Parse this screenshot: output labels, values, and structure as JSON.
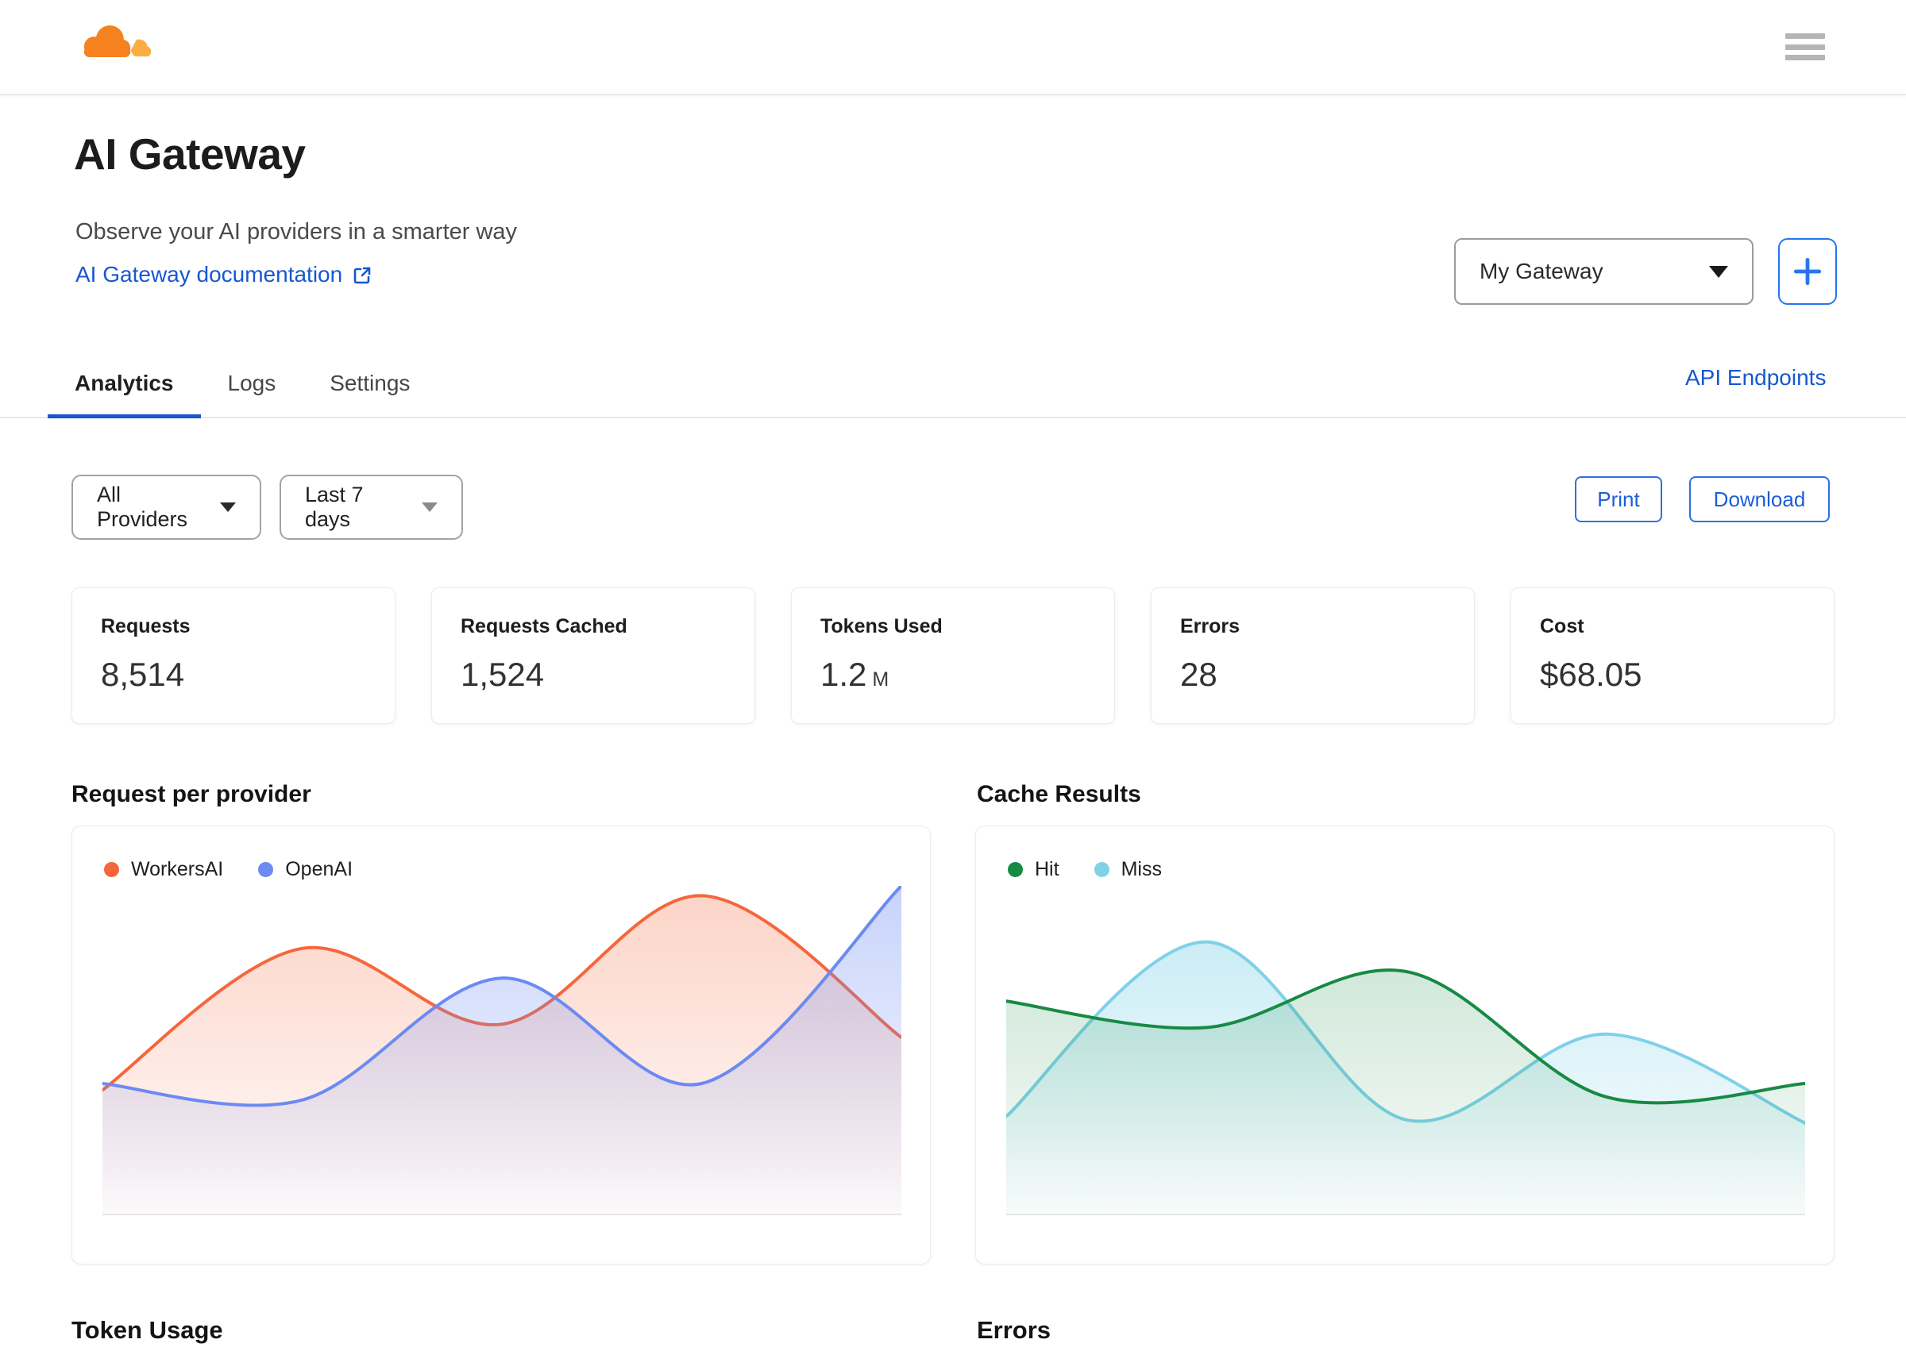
{
  "header": {
    "title": "AI Gateway",
    "subtitle": "Observe your AI providers in a smarter way",
    "doc_link_label": "AI Gateway documentation",
    "gateway_selected": "My Gateway"
  },
  "icons": {
    "menu": "hamburger-icon",
    "doc_external": "external-link-icon",
    "add_gateway": "plus-icon",
    "dropdowns": "chevron-down-icon",
    "logo": "cloudflare-cloud-logo"
  },
  "tabs": {
    "items": [
      {
        "label": "Analytics",
        "active": true
      },
      {
        "label": "Logs",
        "active": false
      },
      {
        "label": "Settings",
        "active": false
      }
    ],
    "api_endpoints_label": "API Endpoints"
  },
  "toolbar": {
    "provider_filter": "All Providers",
    "date_filter": "Last 7 days",
    "print_label": "Print",
    "download_label": "Download"
  },
  "stats": [
    {
      "label": "Requests",
      "value": "8,514",
      "suffix": ""
    },
    {
      "label": "Requests Cached",
      "value": "1,524",
      "suffix": ""
    },
    {
      "label": "Tokens Used",
      "value": "1.2",
      "suffix": "M"
    },
    {
      "label": "Errors",
      "value": "28",
      "suffix": ""
    },
    {
      "label": "Cost",
      "value": "$68.05",
      "suffix": ""
    }
  ],
  "sections": {
    "chart1_title": "Request per provider",
    "chart2_title": "Cache Results",
    "bottom_left_title": "Token Usage",
    "bottom_right_title": "Errors"
  },
  "colors": {
    "accent_blue": "#1757D0",
    "button_blue": "#2576F0",
    "brand_orange": "#F6821F",
    "brand_orange_light": "#FBAD41",
    "workersai_series": "#F6663B",
    "openai_series": "#6B8AF2",
    "hit_series": "#178A43",
    "miss_series": "#7FD1E8",
    "axis_line": "#e8e8e8"
  },
  "chart_data": [
    {
      "type": "area",
      "title": "Request per provider",
      "x": [
        1,
        2,
        3,
        4,
        5
      ],
      "ylim": [
        0,
        100
      ],
      "grid": false,
      "axis_labels_visible": false,
      "legend_position": "top-left",
      "series": [
        {
          "name": "WorkersAI",
          "color": "#F6663B",
          "fill_alpha": 0.28,
          "z": 0,
          "values": [
            38,
            81,
            58,
            97,
            54
          ]
        },
        {
          "name": "OpenAI",
          "color": "#6B8AF2",
          "fill_alpha": 0.38,
          "z": 1,
          "values": [
            40,
            35,
            72,
            40,
            100
          ]
        }
      ]
    },
    {
      "type": "area",
      "title": "Cache Results",
      "x": [
        1,
        2,
        3,
        4,
        5
      ],
      "ylim": [
        0,
        100
      ],
      "grid": false,
      "axis_labels_visible": false,
      "legend_position": "top-left",
      "series": [
        {
          "name": "Hit",
          "color": "#178A43",
          "fill_alpha": 0.2,
          "z": 1,
          "values": [
            65,
            57,
            74,
            36,
            40
          ]
        },
        {
          "name": "Miss",
          "color": "#7FD1E8",
          "fill_alpha": 0.4,
          "z": 0,
          "values": [
            30,
            83,
            29,
            55,
            28
          ]
        }
      ]
    }
  ]
}
